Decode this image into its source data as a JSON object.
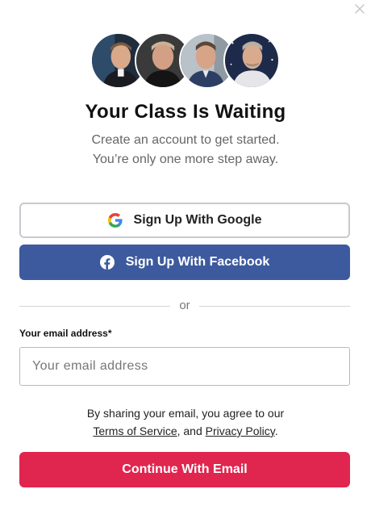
{
  "header": {
    "title": "Your Class Is Waiting",
    "subtitle_line1": "Create an account to get started.",
    "subtitle_line2": "You’re only one more step away."
  },
  "avatars": [
    {
      "icon": "instructor-avatar-1"
    },
    {
      "icon": "instructor-avatar-2"
    },
    {
      "icon": "instructor-avatar-3"
    },
    {
      "icon": "instructor-avatar-4"
    }
  ],
  "social": {
    "google_label": "Sign Up With Google",
    "facebook_label": "Sign Up With Facebook"
  },
  "divider": {
    "text": "or"
  },
  "email": {
    "label": "Your email address*",
    "placeholder": "Your email address",
    "value": ""
  },
  "legal": {
    "line1": "By sharing your email, you agree to our",
    "terms": "Terms of Service",
    "connector": ", and ",
    "privacy": "Privacy Policy",
    "end": "."
  },
  "cta": {
    "label": "Continue With Email"
  },
  "colors": {
    "facebook": "#3d5a9e",
    "cta": "#e0254f",
    "subtitle": "#666666"
  }
}
